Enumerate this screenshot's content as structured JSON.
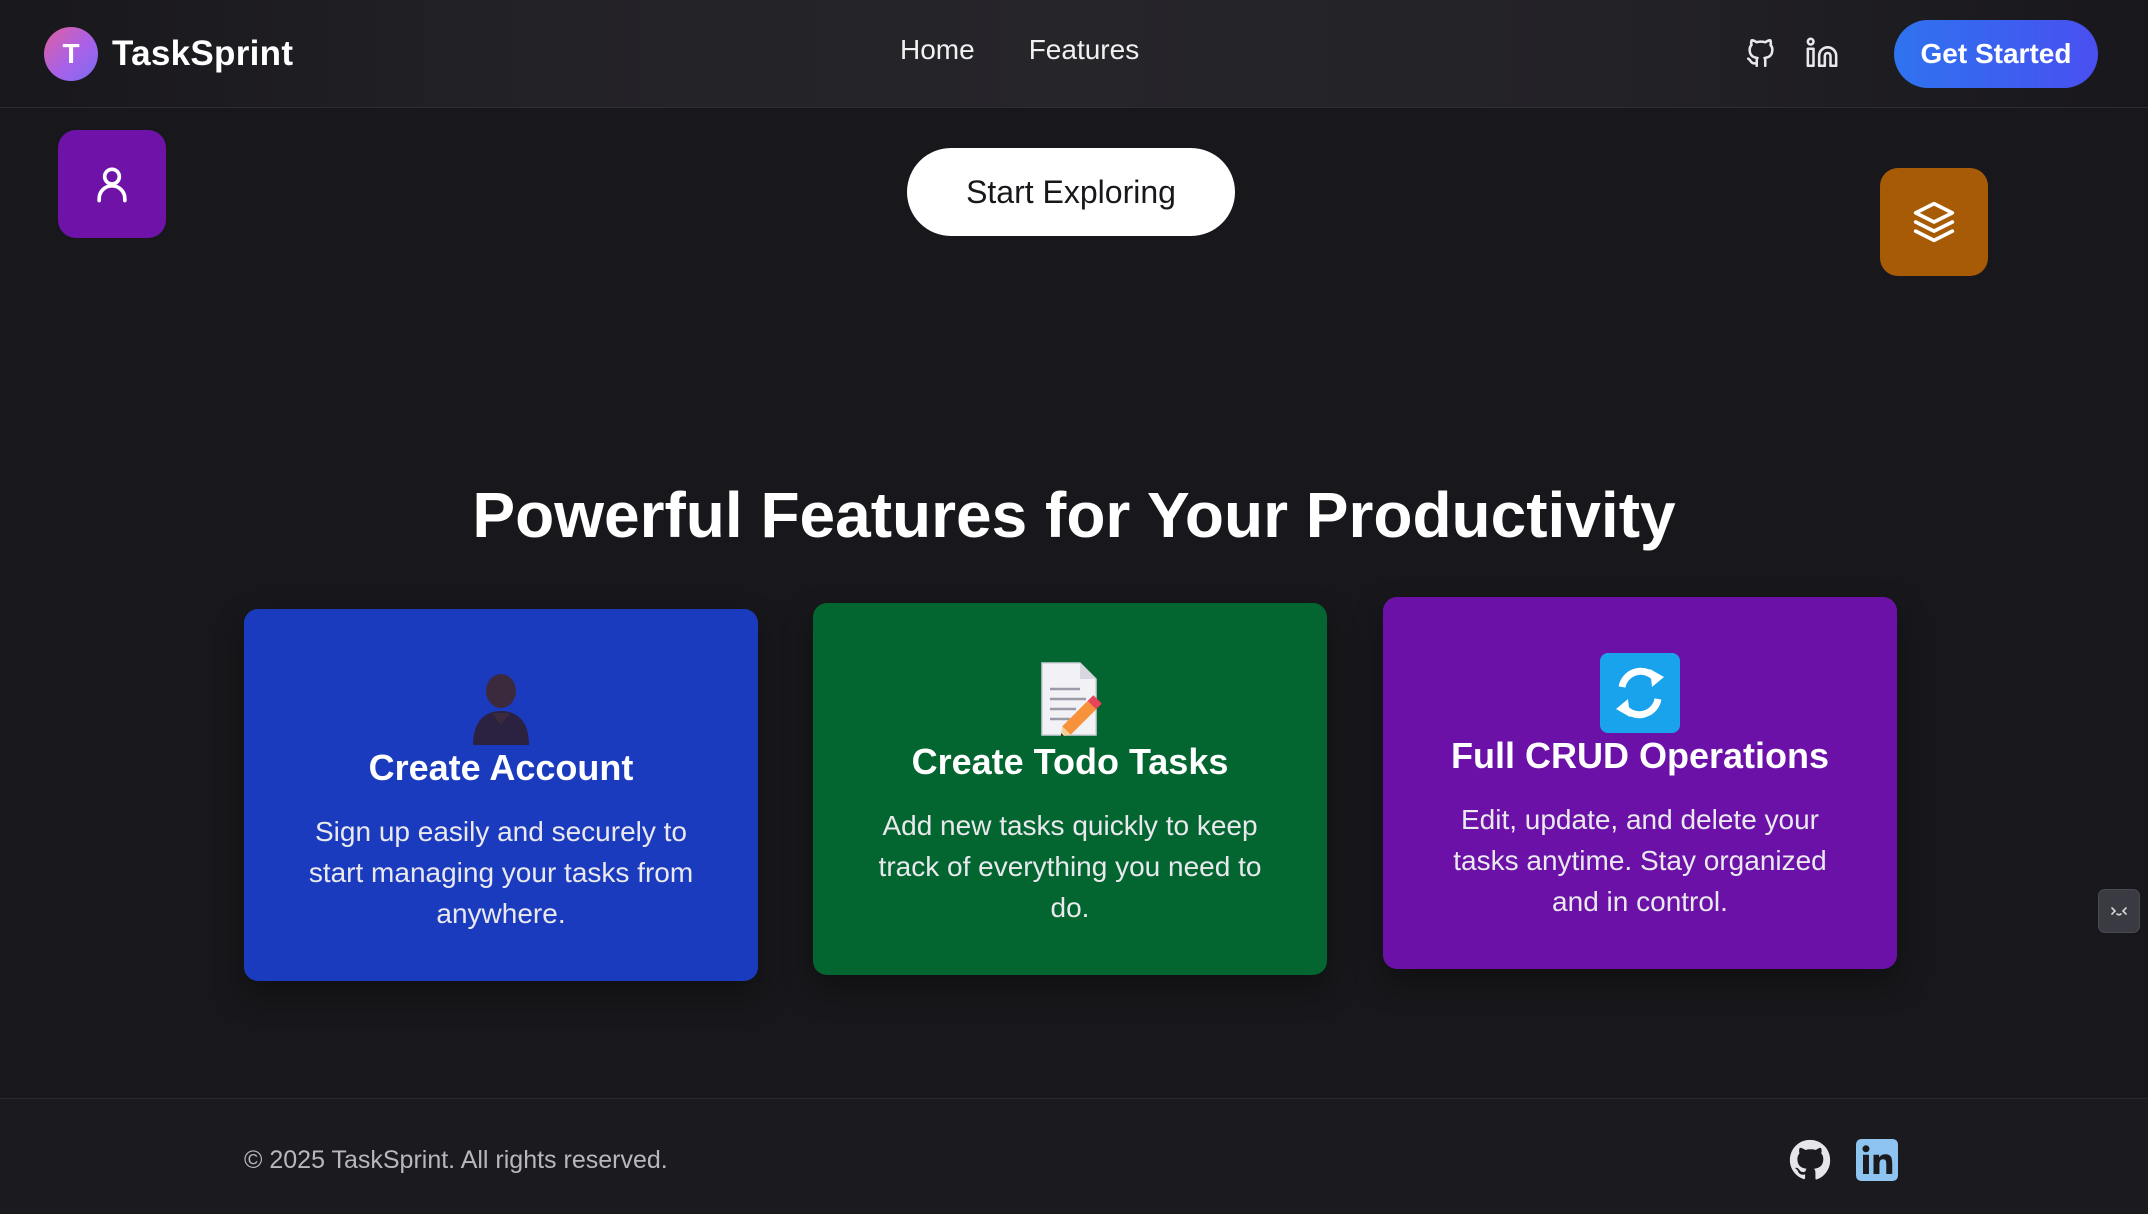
{
  "header": {
    "logo_letter": "T",
    "brand": "TaskSprint",
    "nav": [
      {
        "label": "Home"
      },
      {
        "label": "Features"
      }
    ],
    "icons": [
      "github-icon",
      "linkedin-icon"
    ],
    "cta_label": "Get Started"
  },
  "hero": {
    "start_label": "Start Exploring",
    "tiles": [
      "user-icon",
      "layers-icon"
    ]
  },
  "features": {
    "title": "Powerful Features for Your Productivity",
    "cards": [
      {
        "icon": "person-icon",
        "title": "Create Account",
        "description": "Sign up easily and securely to start managing your tasks from anywhere."
      },
      {
        "icon": "memo-icon",
        "title": "Create Todo Tasks",
        "description": "Add new tasks quickly to keep track of everything you need to do."
      },
      {
        "icon": "refresh-icon",
        "title": "Full CRUD Operations",
        "description": "Edit, update, and delete your tasks anytime. Stay organized and in control."
      }
    ]
  },
  "footer": {
    "copyright": "© 2025 TaskSprint. All rights reserved.",
    "icons": [
      "github-icon",
      "linkedin-icon"
    ]
  },
  "colors": {
    "background": "#18171b",
    "cta_gradient_start": "#2f73ef",
    "cta_gradient_end": "#4a4ff0",
    "card_blue": "#1b3bbe",
    "card_green": "#036630",
    "card_purple": "#6b11a7",
    "tile_purple": "#6f12a8",
    "tile_orange": "#a75b07"
  }
}
